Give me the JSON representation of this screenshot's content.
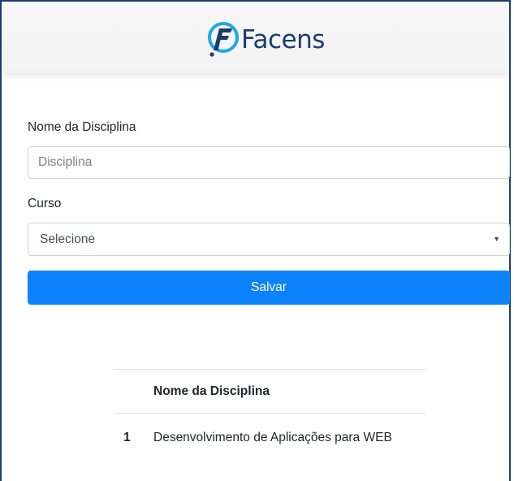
{
  "header": {
    "brand_name": "Facens",
    "brand_color": "#1c3c70",
    "logo_icon": "facens-logo-icon"
  },
  "form": {
    "discipline_label": "Nome da Disciplina",
    "discipline_placeholder": "Disciplina",
    "discipline_value": "",
    "course_label": "Curso",
    "course_selected": "Selecione",
    "save_label": "Salvar",
    "button_color": "#0d83fb"
  },
  "table": {
    "columns": [
      "",
      "Nome da Disciplina"
    ],
    "rows": [
      {
        "index": "1",
        "name": "Desenvolvimento de Aplicações para WEB"
      }
    ]
  }
}
